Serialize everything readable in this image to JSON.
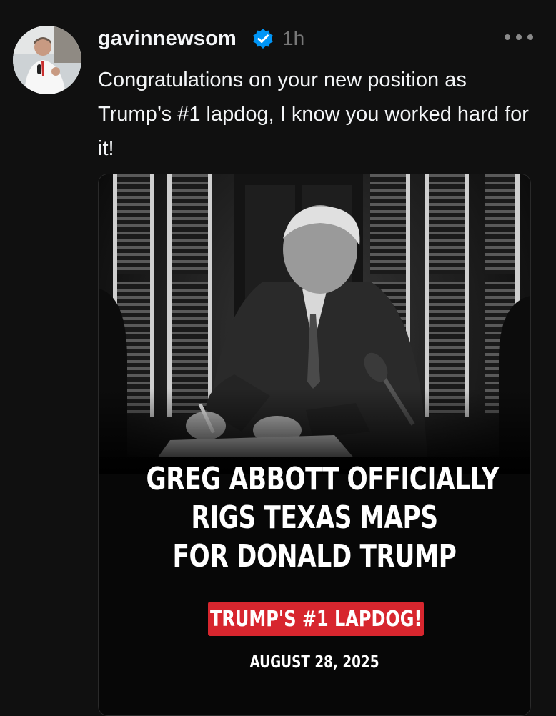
{
  "post": {
    "username": "gavinnewsom",
    "verified_icon": "verified-badge-icon",
    "timestamp": "1h",
    "more_icon": "more-options-icon",
    "caption": "Congratulations on your new position as Trump’s #1 lapdog, I know you worked hard for it!"
  },
  "media": {
    "headline_lines": [
      "GREG ABBOTT OFFICIALLY",
      "RIGS TEXAS MAPS",
      "FOR DONALD TRUMP"
    ],
    "badge_text": "TRUMP'S #1 LAPDOG!",
    "date_text": "AUGUST 28, 2025"
  },
  "colors": {
    "background": "#101010",
    "verified": "#0095f6",
    "badge": "#d7262e",
    "text_primary": "#f3f5f7",
    "text_secondary": "#777777"
  }
}
